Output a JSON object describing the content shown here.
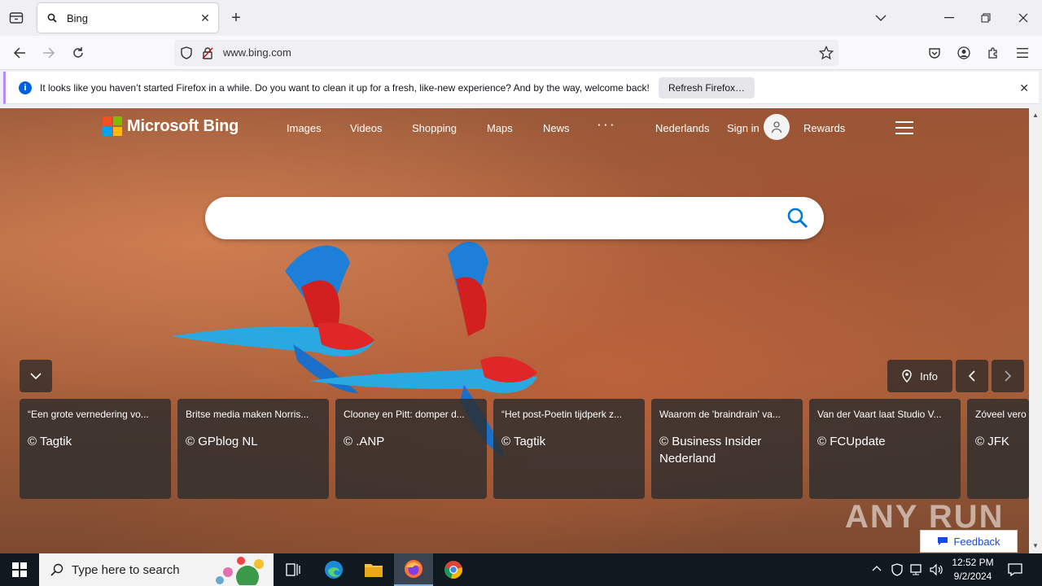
{
  "browser": {
    "tab": {
      "title": "Bing"
    },
    "url": "www.bing.com",
    "notification": {
      "text": "It looks like you haven’t started Firefox in a while. Do you want to clean it up for a fresh, like-new experience? And by the way, welcome back!",
      "button_label": "Refresh Firefox…"
    }
  },
  "bing": {
    "logo_text": "Microsoft Bing",
    "nav": [
      "Images",
      "Videos",
      "Shopping",
      "Maps",
      "News",
      "· · ·"
    ],
    "language": "Nederlands",
    "signin": "Sign in",
    "rewards": "Rewards",
    "search_placeholder": "",
    "info_label": "Info",
    "cards": [
      {
        "title": "“Een grote vernedering vo...",
        "source": "© Tagtik"
      },
      {
        "title": "Britse media maken Norris...",
        "source": "© GPblog NL"
      },
      {
        "title": "Clooney en Pitt: domper d...",
        "source": "© .ANP"
      },
      {
        "title": "“Het post-Poetin tijdperk z...",
        "source": "© Tagtik"
      },
      {
        "title": "Waarom de 'braindrain' va...",
        "source": "© Business Insider Nederland"
      },
      {
        "title": "Van der Vaart laat Studio V...",
        "source": "© FCUpdate"
      },
      {
        "title": "Zóveel vero",
        "source": "© JFK"
      }
    ],
    "feedback_label": "Feedback",
    "watermark": "ANY RUN"
  },
  "taskbar": {
    "search_placeholder": "Type here to search",
    "time": "12:52 PM",
    "date": "9/2/2024"
  },
  "colors": {
    "ms_red": "#f25022",
    "ms_green": "#7fba00",
    "ms_blue": "#00a4ef",
    "ms_yellow": "#ffb900",
    "search_icon": "#0078d4",
    "notification_accent": "#b18cf2"
  }
}
